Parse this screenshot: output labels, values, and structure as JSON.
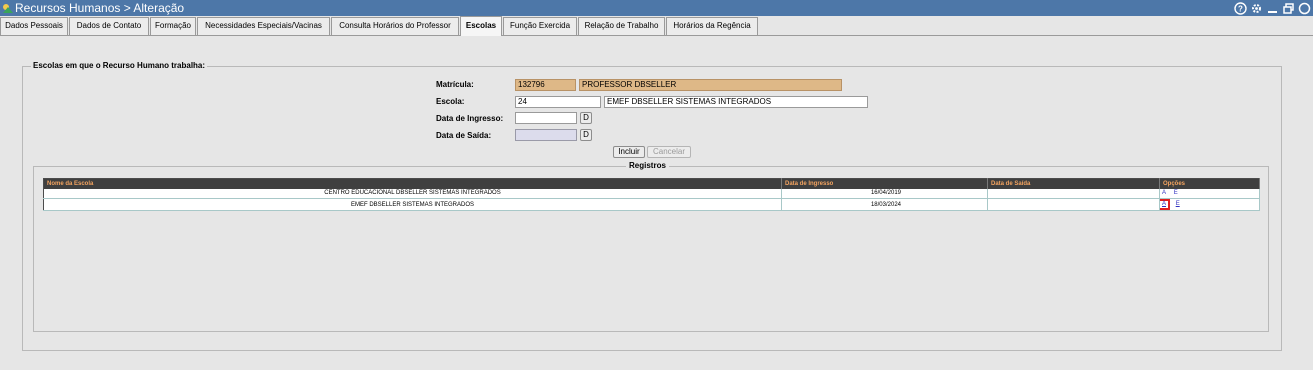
{
  "window": {
    "title": "Recursos Humanos > Alteração",
    "controls": [
      "help-icon",
      "settings-icon",
      "minimize-icon",
      "restore-icon",
      "close-icon"
    ]
  },
  "tabs": [
    {
      "label": "Dados Pessoais"
    },
    {
      "label": "Dados de Contato"
    },
    {
      "label": "Formação"
    },
    {
      "label": "Necessidades Especiais/Vacinas"
    },
    {
      "label": "Consulta Horários do Professor"
    },
    {
      "label": "Escolas",
      "active": true
    },
    {
      "label": "Função Exercida"
    },
    {
      "label": "Relação de Trabalho"
    },
    {
      "label": "Horários da Regência"
    }
  ],
  "form": {
    "legend": "Escolas em que o Recurso Humano trabalha:",
    "matricula_label": "Matrícula:",
    "matricula_value": "132796",
    "matricula_name": "PROFESSOR DBSELLER",
    "escola_label": "Escola:",
    "escola_code": "24",
    "escola_name": "EMEF DBSELLER SISTEMAS INTEGRADOS",
    "ingresso_label": "Data de Ingresso:",
    "ingresso_value": "",
    "saida_label": "Data de Saída:",
    "saida_value": "",
    "date_button": "D",
    "incluir": "Incluir",
    "cancelar": "Cancelar"
  },
  "registros": {
    "legend": "Registros",
    "columns": [
      "Nome da Escola",
      "Data de Ingresso",
      "Data de Saída",
      "Opções"
    ],
    "rows": [
      {
        "escola": "CENTRO EDUCACIONAL DBSELLER SISTEMAS INTEGRADOS",
        "ingresso": "16/04/2019",
        "saida": "",
        "opt_a": "A",
        "opt_e": "E"
      },
      {
        "escola": "EMEF DBSELLER SISTEMAS INTEGRADOS",
        "ingresso": "18/03/2024",
        "saida": "",
        "opt_a": "A",
        "opt_e": "E"
      }
    ]
  },
  "colors": {
    "titlebar": "#4d77a8",
    "readonly_field": "#deb887",
    "grid_header": "#3f3f3f",
    "grid_header_text": "#f4a460",
    "highlight": "#e02020"
  }
}
